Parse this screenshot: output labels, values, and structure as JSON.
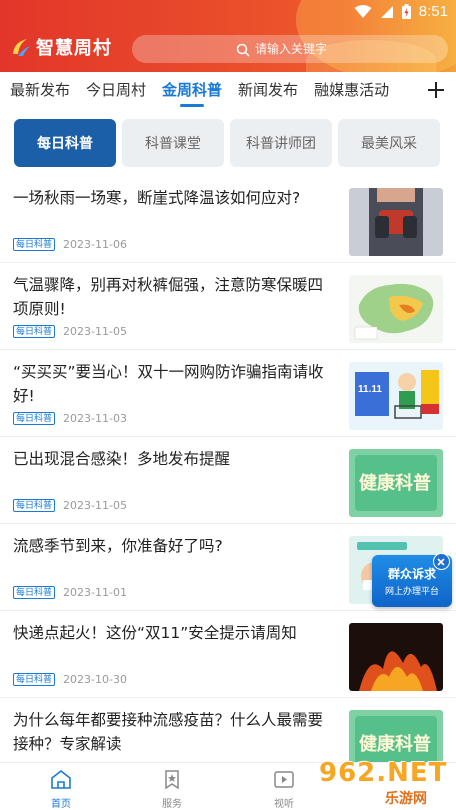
{
  "status_bar": {
    "time": "8:51"
  },
  "app": {
    "name": "智慧周村",
    "logo_icon": "swoosh-logo"
  },
  "search": {
    "placeholder": "请输入关键字",
    "icon": "search-icon"
  },
  "tabs": [
    {
      "label": "最新发布"
    },
    {
      "label": "今日周村"
    },
    {
      "label": "金周科普",
      "active": true
    },
    {
      "label": "新闻发布"
    },
    {
      "label": "融媒惠活动"
    }
  ],
  "add_tab_icon": "plus-icon",
  "subtabs": [
    {
      "label": "每日科普",
      "active": true
    },
    {
      "label": "科普课堂"
    },
    {
      "label": "科普讲师团"
    },
    {
      "label": "最美风采"
    }
  ],
  "news": [
    {
      "title": "一场秋雨一场寒，断崖式降温该如何应对?",
      "tag": "每日科普",
      "date": "2023-11-06"
    },
    {
      "title": "气温骤降，别再对秋裤倔强，注意防寒保暖四项原则!",
      "tag": "每日科普",
      "date": "2023-11-05"
    },
    {
      "title": "“买买买”要当心！双十一网购防诈骗指南请收好!",
      "tag": "每日科普",
      "date": "2023-11-03",
      "thumb_text": "11.11"
    },
    {
      "title": "已出现混合感染！多地发布提醒",
      "tag": "每日科普",
      "date": "2023-11-05",
      "thumb_text": "健康科普"
    },
    {
      "title": "流感季节到来，你准备好了吗?",
      "tag": "每日科普",
      "date": "2023-11-01"
    },
    {
      "title": "快递点起火！这份“双11”安全提示请周知",
      "tag": "每日科普",
      "date": "2023-10-30"
    },
    {
      "title": "为什么每年都要接种流感疫苗？什么人最需要接种？专家解读",
      "tag": "",
      "date": "",
      "thumb_text": "健康科普"
    }
  ],
  "floating_ad": {
    "line1": "群众诉求",
    "line2": "网上办理平台"
  },
  "bottom_nav": [
    {
      "label": "首页",
      "icon": "home-icon",
      "active": true
    },
    {
      "label": "服务",
      "icon": "bookmark-star-icon"
    },
    {
      "label": "视听",
      "icon": "video-icon"
    }
  ],
  "watermark": {
    "big": "962.NET",
    "small": "乐游网"
  },
  "colors": {
    "accent": "#1a7ad6",
    "header_red": "#e2362a",
    "subtab_active": "#1a5fa8"
  }
}
